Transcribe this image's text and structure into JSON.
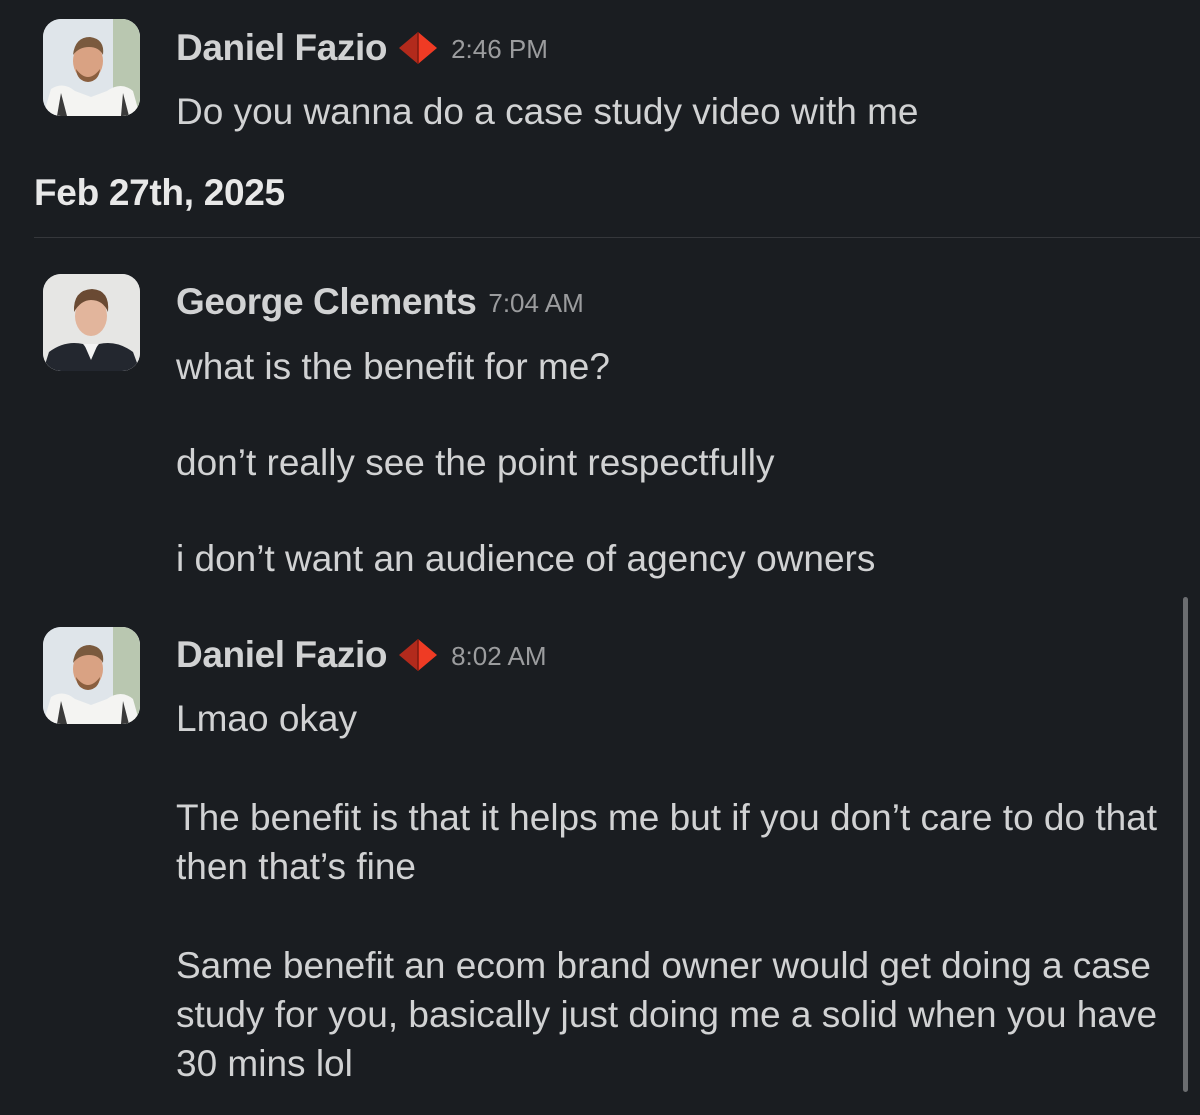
{
  "messages": [
    {
      "author": "Daniel Fazio",
      "time": "2:46 PM",
      "lines": [
        "Do you wanna do a case study video with me"
      ]
    },
    {
      "author": "George Clements",
      "time": "7:04 AM",
      "lines": [
        "what is the benefit for me?",
        "don’t really see the point respectfully",
        "i don’t want an audience of agency owners"
      ]
    },
    {
      "author": "Daniel Fazio",
      "time": "8:02 AM",
      "lines": [
        "Lmao okay",
        "The benefit is that it helps me but if you don’t care to do that then that’s fine",
        "Same benefit an ecom brand owner would get doing a case study for you, basically just doing me a solid when you have 30 mins lol"
      ]
    }
  ],
  "date_divider": "Feb 27th, 2025",
  "icons": {
    "author_badge": "red-pyramid-icon"
  },
  "colors": {
    "background": "#1a1d21",
    "text": "#d1d2d3",
    "timestamp": "#9b9c9e",
    "badge": "#e0301e"
  }
}
